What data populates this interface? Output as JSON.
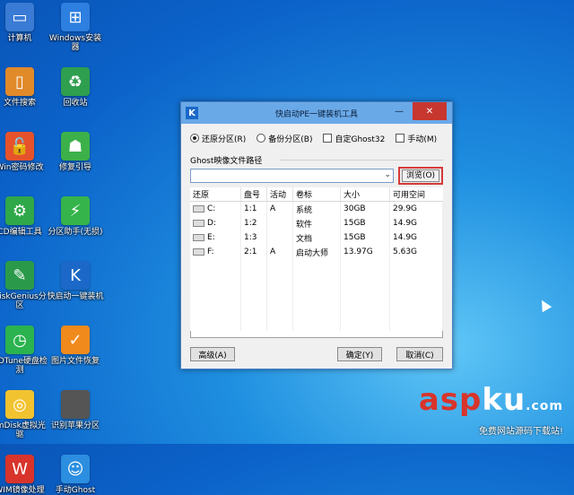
{
  "desktop_icons": [
    {
      "label": "计算机",
      "icon": "computer-icon",
      "color": "#3a7bd5",
      "glyph": "▭"
    },
    {
      "label": "Windows安装器",
      "icon": "windows-icon",
      "color": "#2d7fe0",
      "glyph": "⊞"
    },
    {
      "label": "文件搜索",
      "icon": "book-icon",
      "color": "#e08a2a",
      "glyph": "▯"
    },
    {
      "label": "回收站",
      "icon": "recycle-bin-icon",
      "color": "#2e9e4f",
      "glyph": "♻"
    },
    {
      "label": "Win密码修改",
      "icon": "lock-icon",
      "color": "#e6522c",
      "glyph": "🔓"
    },
    {
      "label": "修复引导",
      "icon": "runner-icon",
      "color": "#3cb14a",
      "glyph": "☗"
    },
    {
      "label": "CD编辑工具",
      "icon": "gear-icon",
      "color": "#2fa84a",
      "glyph": "⚙"
    },
    {
      "label": "分区助手(无损)",
      "icon": "flash-icon",
      "color": "#35b44b",
      "glyph": "⚡"
    },
    {
      "label": "DiskGenius分区",
      "icon": "wrench-icon",
      "color": "#2a9a4a",
      "glyph": "✎"
    },
    {
      "label": "快启动一键装机",
      "icon": "k-logo-icon",
      "color": "#1b68c8",
      "glyph": "K"
    },
    {
      "label": "HDTune硬盘检测",
      "icon": "clock-icon",
      "color": "#2bb34f",
      "glyph": "◷"
    },
    {
      "label": "图片文件恢复",
      "icon": "shield-icon",
      "color": "#f08a1d",
      "glyph": "✓"
    },
    {
      "label": "ImDisk虚拟光驱",
      "icon": "disc-icon",
      "color": "#f2c330",
      "glyph": "◎"
    },
    {
      "label": "识别苹果分区",
      "icon": "apple-icon",
      "color": "#555555",
      "glyph": ""
    },
    {
      "label": "WIM镜像处理",
      "icon": "wim-icon",
      "color": "#d8342c",
      "glyph": "W"
    },
    {
      "label": "手动Ghost",
      "icon": "ghost-icon",
      "color": "#2c8ee0",
      "glyph": "☺"
    }
  ],
  "window": {
    "app_icon": "K",
    "title": "快启动PE一键装机工具",
    "minimize": "—",
    "close": "✕",
    "options": {
      "restore": "还原分区(R)",
      "backup": "备份分区(B)",
      "auto_ghost32": "自定Ghost32",
      "manual": "手动(M)"
    },
    "image_path_label": "Ghost映像文件路径",
    "path_value": "",
    "browse_label": "浏览(O)",
    "columns": [
      "还原",
      "盘号",
      "活动",
      "卷标",
      "大小",
      "可用空间"
    ],
    "rows": [
      {
        "drive": "C:",
        "num": "1:1",
        "active": "A",
        "label": "系统",
        "size": "30GB",
        "free": "29.9G"
      },
      {
        "drive": "D:",
        "num": "1:2",
        "active": "",
        "label": "软件",
        "size": "15GB",
        "free": "14.9G"
      },
      {
        "drive": "E:",
        "num": "1:3",
        "active": "",
        "label": "文档",
        "size": "15GB",
        "free": "14.9G"
      },
      {
        "drive": "F:",
        "num": "2:1",
        "active": "A",
        "label": "启动大师",
        "size": "13.97G",
        "free": "5.63G"
      }
    ],
    "buttons": {
      "advanced": "高级(A)",
      "ok": "确定(Y)",
      "cancel": "取消(C)"
    }
  },
  "watermark": {
    "part1": "asp",
    "part2": "ku",
    "part3": ".com",
    "subtitle": "免费网站源码下载站!"
  }
}
